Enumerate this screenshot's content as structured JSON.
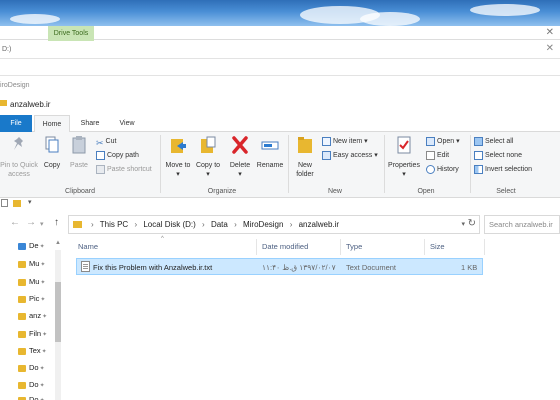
{
  "background_windows": {
    "drive_tools_label": "Drive Tools",
    "window2_label": "D:)",
    "window4_label": "iroDesign"
  },
  "window": {
    "title": "anzalweb.ir"
  },
  "ribbon_tabs": [
    "File",
    "Home",
    "Share",
    "View"
  ],
  "ribbon": {
    "clipboard": {
      "pin_to_quick_access": "Pin to Quick access",
      "copy": "Copy",
      "paste": "Paste",
      "cut": "Cut",
      "copy_path": "Copy path",
      "paste_shortcut": "Paste shortcut",
      "label": "Clipboard"
    },
    "organize": {
      "move_to": "Move to",
      "copy_to": "Copy to",
      "delete": "Delete",
      "rename": "Rename",
      "label": "Organize"
    },
    "new": {
      "new_folder": "New folder",
      "new_item": "New item",
      "easy_access": "Easy access",
      "label": "New"
    },
    "open": {
      "properties": "Properties",
      "open": "Open",
      "edit": "Edit",
      "history": "History",
      "label": "Open"
    },
    "select": {
      "select_all": "Select all",
      "select_none": "Select none",
      "invert_selection": "Invert selection",
      "label": "Select"
    }
  },
  "address": {
    "crumbs": [
      "This PC",
      "Local Disk (D:)",
      "Data",
      "MiroDesign",
      "anzalweb.ir"
    ],
    "search_placeholder": "Search anzalweb.ir"
  },
  "nav_items": [
    "De",
    "Mu",
    "Mu",
    "Pic",
    "anz",
    "Filn",
    "Tex",
    "Do",
    "Do",
    "Do"
  ],
  "columns": {
    "name": "Name",
    "date_modified": "Date modified",
    "type": "Type",
    "size": "Size"
  },
  "files": [
    {
      "name": "Fix this Problem with Anzalweb.ir.txt",
      "date_modified": "۱۳۹۷/۰۲/۰۷ ق.ظ ۱۱:۴۰",
      "type": "Text Document",
      "size": "1 KB"
    }
  ],
  "colors": {
    "accent": "#1979ca",
    "selection": "#cce8ff",
    "folder": "#e8b730",
    "delete_red": "#d9262b"
  }
}
